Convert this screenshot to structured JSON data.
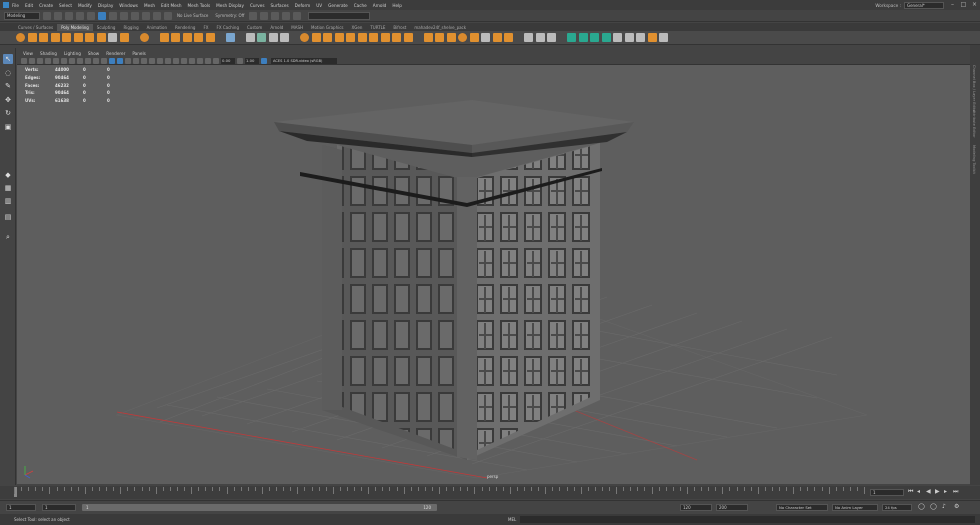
{
  "menubar": {
    "items": [
      "File",
      "Edit",
      "Create",
      "Select",
      "Modify",
      "Display",
      "Windows",
      "Mesh",
      "Edit Mesh",
      "Mesh Tools",
      "Mesh Display",
      "Curves",
      "Surfaces",
      "Deform",
      "UV",
      "Generate",
      "Cache",
      "Arnold",
      "Help"
    ],
    "workspace_label": "Workspace :",
    "workspace_value": "General*"
  },
  "statusline": {
    "mode": "Modeling",
    "live_surface": "No Live Surface",
    "symmetry": "Symmetry: Off"
  },
  "shelf_tabs": [
    "Curves / Surfaces",
    "Poly Modeling",
    "Sculpting",
    "Rigging",
    "Animation",
    "Rendering",
    "FX",
    "FX Caching",
    "Custom",
    "Arnold",
    "MASH",
    "Motion Graphics",
    "XGen",
    "TURTLE",
    "Bifrost",
    "mahadev24f_shelve_pack"
  ],
  "shelf_active_tab": "Poly Modeling",
  "panel_menu": [
    "View",
    "Shading",
    "Lighting",
    "Show",
    "Renderer",
    "Panels"
  ],
  "panel_tools": {
    "value_a": "0.00",
    "value_b": "1.00",
    "colorspace": "ACES 1.0 SDR-video (sRGB)"
  },
  "hud": {
    "rows": [
      {
        "label": "Verts:",
        "value": "44000",
        "c1": "0",
        "c2": "0"
      },
      {
        "label": "Edges:",
        "value": "90464",
        "c1": "0",
        "c2": "0"
      },
      {
        "label": "Faces:",
        "value": "46232",
        "c1": "0",
        "c2": "0"
      },
      {
        "label": "Tris:",
        "value": "90464",
        "c1": "0",
        "c2": "0"
      },
      {
        "label": "UVs:",
        "value": "61638",
        "c1": "0",
        "c2": "0"
      }
    ]
  },
  "camera_label": "persp",
  "right_tabs": [
    "Channel Box / Layer Editor",
    "Attribute Editor",
    "Modeling Toolkit"
  ],
  "timeslider": {
    "current_frame": "1"
  },
  "rangeslider": {
    "start": "1",
    "start_inner": "1",
    "range_in": "1",
    "range_out": "120",
    "end_inner": "120",
    "end": "200",
    "character_set": "No Character Set",
    "anim_layer": "No Anim Layer",
    "fps": "24 fps"
  },
  "helpline": {
    "text": "Select Tool: select an object",
    "mel_label": "MEL"
  },
  "colors": {
    "viewport_bg": "#5e5e5e",
    "shelf_orange": "#d98a2e",
    "selection_blue": "#5b87b8"
  }
}
